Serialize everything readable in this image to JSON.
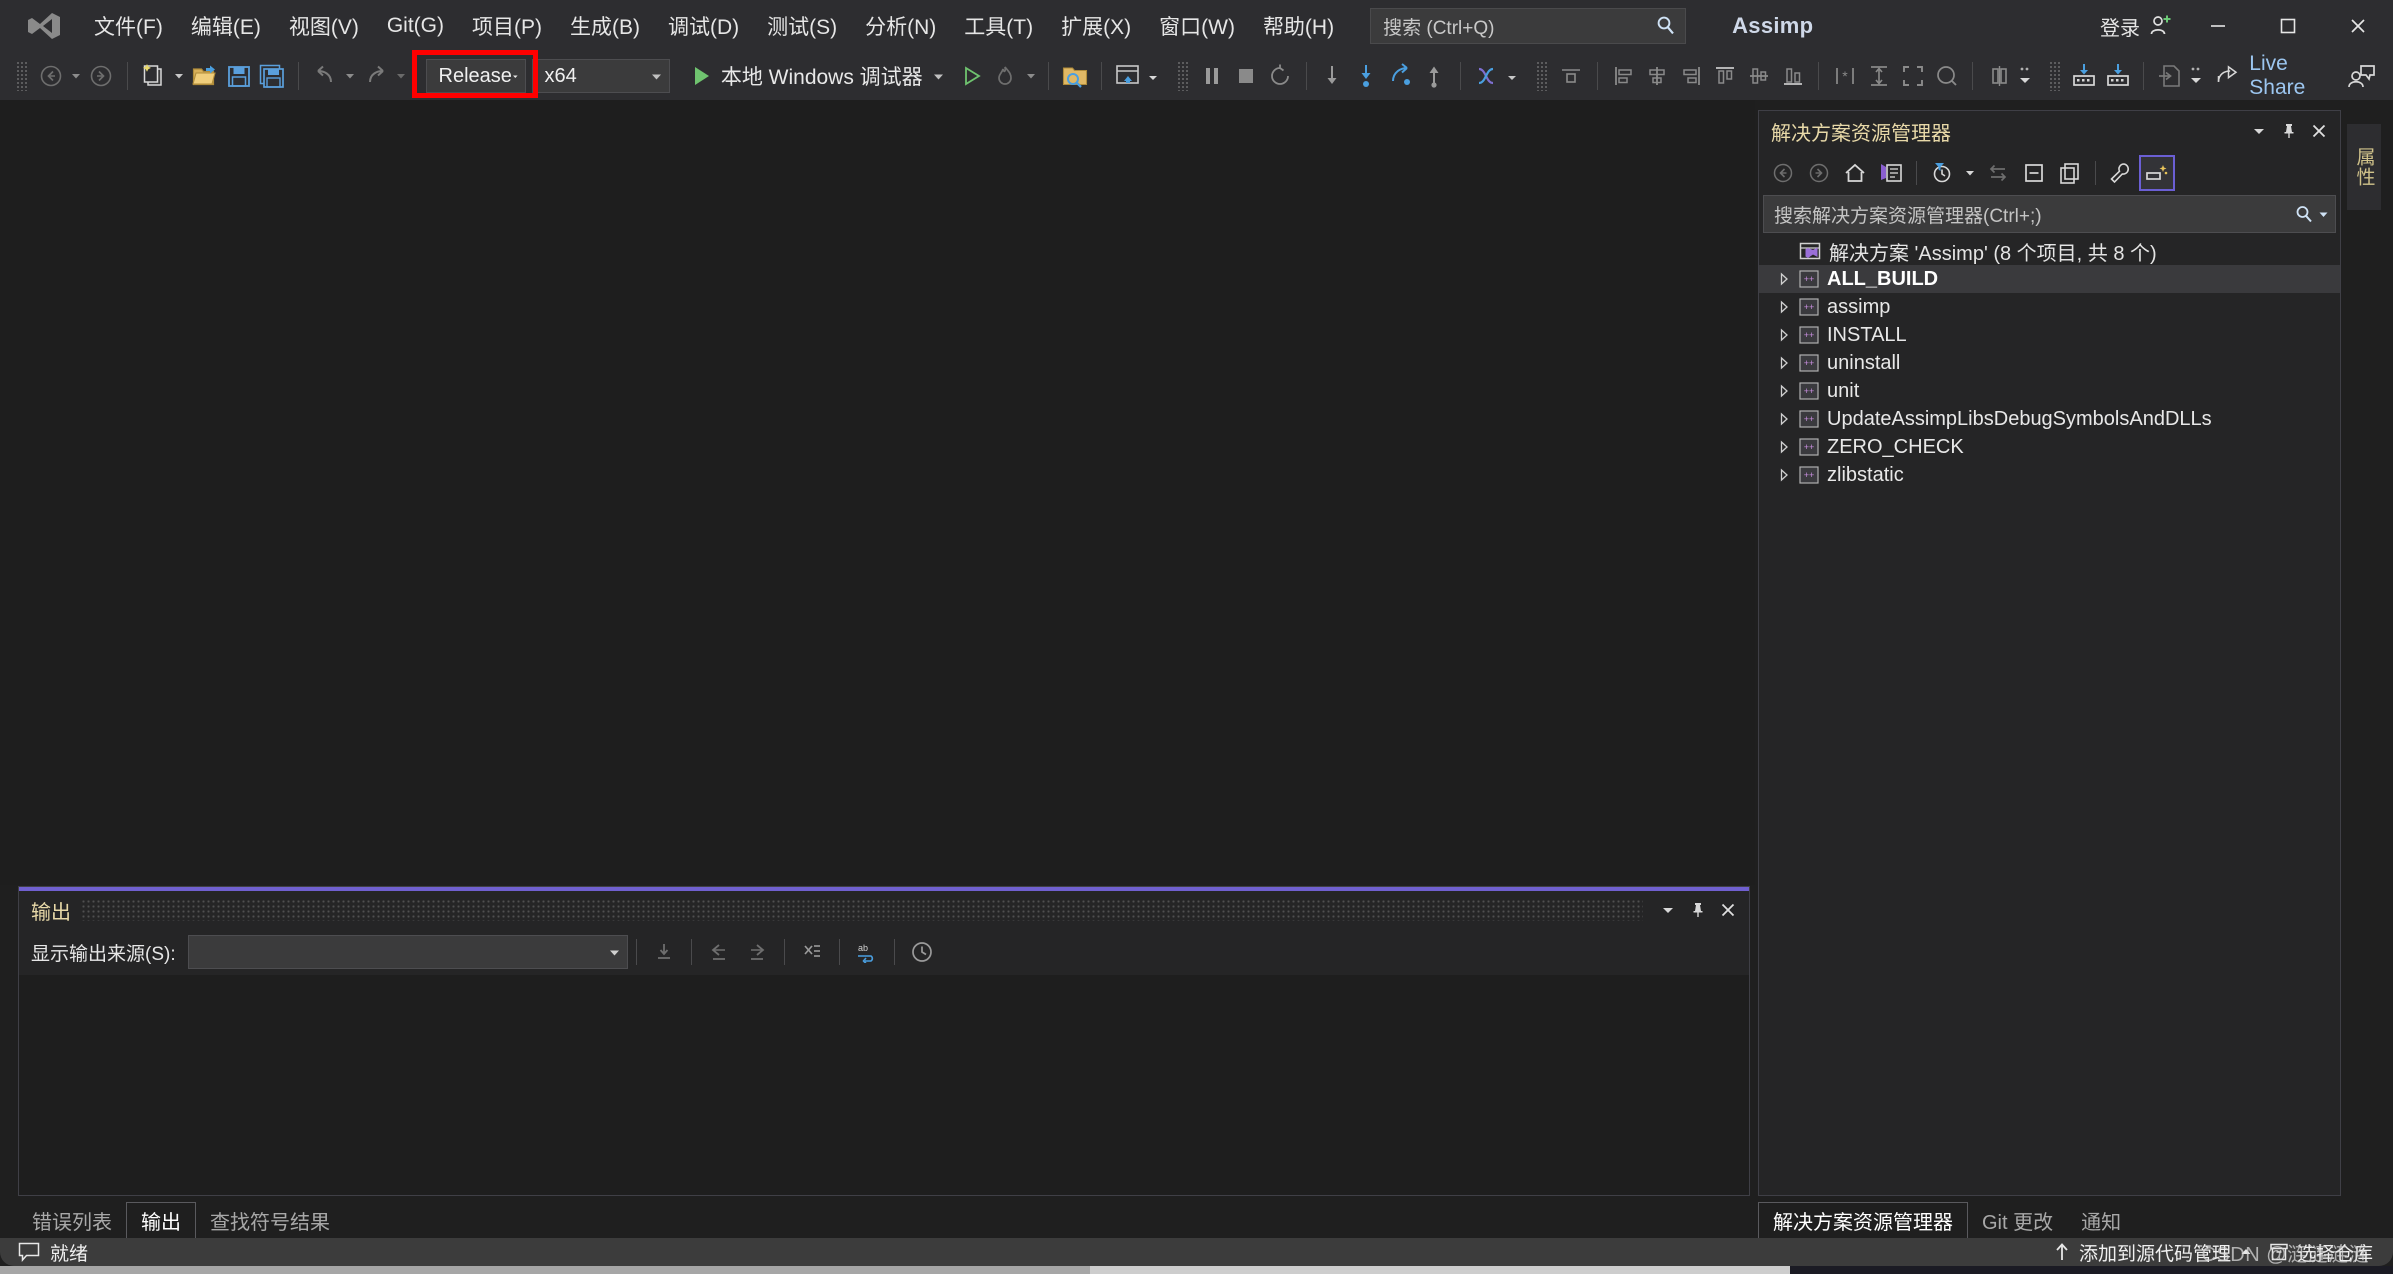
{
  "window": {
    "app_title": "Assimp",
    "signin_label": "登录",
    "minimize_icon": "minimize-icon",
    "maximize_icon": "maximize-icon",
    "close_icon": "close-icon"
  },
  "menubar": {
    "logo_icon": "visual-studio-logo",
    "items": [
      {
        "label": "文件(F)"
      },
      {
        "label": "编辑(E)"
      },
      {
        "label": "视图(V)"
      },
      {
        "label": "Git(G)"
      },
      {
        "label": "项目(P)"
      },
      {
        "label": "生成(B)"
      },
      {
        "label": "调试(D)"
      },
      {
        "label": "测试(S)"
      },
      {
        "label": "分析(N)"
      },
      {
        "label": "工具(T)"
      },
      {
        "label": "扩展(X)"
      },
      {
        "label": "窗口(W)"
      },
      {
        "label": "帮助(H)"
      }
    ]
  },
  "search": {
    "placeholder": "搜索 (Ctrl+Q)",
    "icon": "search-icon"
  },
  "toolbar": {
    "nav_back_icon": "navigate-back-icon",
    "nav_forward_icon": "navigate-forward-icon",
    "new_project_icon": "new-project-icon",
    "open_file_icon": "open-file-icon",
    "save_icon": "save-icon",
    "save_all_icon": "save-all-icon",
    "undo_icon": "undo-icon",
    "redo_icon": "redo-icon",
    "configuration": "Release",
    "platform": "x64",
    "configuration_highlighted": true,
    "highlight_color": "#ff0000",
    "start_debug_label": "本地 Windows 调试器",
    "start_debug_icon": "play-icon",
    "start_without_debug_icon": "play-outline-icon",
    "hot_reload_icon": "hot-reload-icon",
    "attach_icon": "attach-to-process-icon",
    "window_layout_icon": "window-layout-icon",
    "pause_icon": "pause-icon",
    "stop_icon": "stop-icon",
    "restart_icon": "restart-icon",
    "step_into_icon": "step-into-icon",
    "step_over_icon": "step-over-icon",
    "step_out_icon": "step-out-icon",
    "thread_icon": "thread-icon",
    "process_icon": "process-icon",
    "align_left_icon": "align-left-icon",
    "align_center_icon": "align-center-icon",
    "align_right_icon": "align-right-icon",
    "align_top_icon": "align-top-icon",
    "align_middle_icon": "align-middle-icon",
    "align_bottom_icon": "align-bottom-icon",
    "spacing_icon": "make-spacing-equal-icon",
    "size_height_icon": "size-height-icon",
    "size_both_icon": "size-both-icon",
    "zoom_icon": "zoom-icon",
    "center_horiz_icon": "center-horizontally-icon",
    "toolbox_icon": "toolbox-icon",
    "toolbox2_icon": "toolbox-alt-icon",
    "export_icon": "export-icon",
    "live_share_label": "Live Share",
    "live_share_icon": "live-share-icon",
    "live_share_user_icon": "share-user-icon"
  },
  "output_panel": {
    "title": "输出",
    "accent_color": "#7060d0",
    "source_label": "显示输出来源(S):",
    "source_value": "",
    "source_caret_icon": "chevron-down-icon",
    "dropdown_icon": "chevron-down-icon",
    "pin_icon": "pin-icon",
    "close_icon": "close-icon",
    "buttons": [
      {
        "icon": "go-to-message-icon"
      },
      {
        "icon": "previous-message-icon"
      },
      {
        "icon": "next-message-icon"
      },
      {
        "icon": "clear-all-icon"
      },
      {
        "icon": "toggle-word-wrap-icon"
      },
      {
        "icon": "show-timestamps-icon"
      }
    ],
    "content": ""
  },
  "bottom_tabs": [
    {
      "label": "错误列表",
      "active": false
    },
    {
      "label": "输出",
      "active": true
    },
    {
      "label": "查找符号结果",
      "active": false
    }
  ],
  "solution_explorer": {
    "title": "解决方案资源管理器",
    "dropdown_icon": "chevron-down-icon",
    "pin_icon": "pin-icon",
    "close_icon": "close-icon",
    "toolbar": [
      {
        "icon": "back-icon",
        "selected": false
      },
      {
        "icon": "forward-icon",
        "selected": false
      },
      {
        "icon": "home-icon",
        "selected": false
      },
      {
        "icon": "solution-view-icon",
        "selected": false
      },
      {
        "icon": "pending-changes-filter-icon",
        "selected": false
      },
      {
        "icon": "sync-with-active-document-icon",
        "selected": false
      },
      {
        "icon": "collapse-all-icon",
        "selected": false
      },
      {
        "icon": "show-all-files-icon",
        "selected": false
      },
      {
        "icon": "properties-icon",
        "selected": false
      },
      {
        "icon": "preview-selected-items-icon",
        "selected": true
      }
    ],
    "search_placeholder": "搜索解决方案资源管理器(Ctrl+;)",
    "search_icon": "search-icon",
    "search_caret_icon": "chevron-down-icon",
    "solution_node": {
      "label": "解决方案 'Assimp' (8 个项目, 共 8 个)",
      "icon": "solution-icon"
    },
    "projects": [
      {
        "label": "ALL_BUILD",
        "icon": "cpp-project-icon",
        "selected": true,
        "expander": "chevron-right-icon"
      },
      {
        "label": "assimp",
        "icon": "cpp-project-icon",
        "selected": false,
        "expander": "chevron-right-icon"
      },
      {
        "label": "INSTALL",
        "icon": "cpp-project-icon",
        "selected": false,
        "expander": "chevron-right-icon"
      },
      {
        "label": "uninstall",
        "icon": "cpp-project-icon",
        "selected": false,
        "expander": "chevron-right-icon"
      },
      {
        "label": "unit",
        "icon": "cpp-project-icon",
        "selected": false,
        "expander": "chevron-right-icon"
      },
      {
        "label": "UpdateAssimpLibsDebugSymbolsAndDLLs",
        "icon": "cpp-project-icon",
        "selected": false,
        "expander": "chevron-right-icon"
      },
      {
        "label": "ZERO_CHECK",
        "icon": "cpp-project-icon",
        "selected": false,
        "expander": "chevron-right-icon"
      },
      {
        "label": "zlibstatic",
        "icon": "cpp-project-icon",
        "selected": false,
        "expander": "chevron-right-icon"
      }
    ]
  },
  "solex_tabs": [
    {
      "label": "解决方案资源管理器",
      "active": true
    },
    {
      "label": "Git 更改",
      "active": false
    },
    {
      "label": "通知",
      "active": false
    }
  ],
  "vertical_tab": {
    "label": "属性"
  },
  "statusbar": {
    "status_icon": "speech-bubble-icon",
    "status_text": "就绪",
    "source_control_icon": "arrow-up-icon",
    "source_control_label": "添加到源代码管理",
    "source_control_caret_icon": "chevron-up-icon",
    "repository_icon": "repository-icon",
    "repository_label": "选择仓库",
    "watermark": "CSDN @涟涟涟涟"
  }
}
